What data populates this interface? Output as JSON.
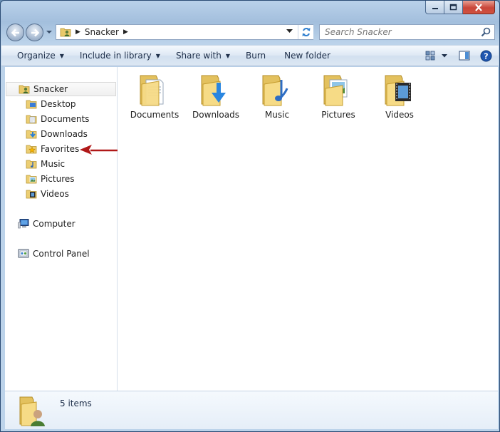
{
  "window": {
    "title": "Snacker",
    "caption": {
      "minimize": "minimize-icon",
      "maximize": "maximize-icon",
      "close": "close-icon"
    }
  },
  "address": {
    "path": [
      "Snacker"
    ],
    "search_placeholder": "Search Snacker"
  },
  "toolbar": {
    "organize": "Organize",
    "include_in_library": "Include in library",
    "share_with": "Share with",
    "burn": "Burn",
    "new_folder": "New folder"
  },
  "navpane": {
    "root": "Snacker",
    "children": [
      "Desktop",
      "Documents",
      "Downloads",
      "Favorites",
      "Music",
      "Pictures",
      "Videos"
    ],
    "computer": "Computer",
    "control_panel": "Control Panel"
  },
  "content": {
    "items": [
      {
        "label": "Documents",
        "icon": "documents-folder-icon"
      },
      {
        "label": "Downloads",
        "icon": "downloads-folder-icon"
      },
      {
        "label": "Music",
        "icon": "music-folder-icon"
      },
      {
        "label": "Pictures",
        "icon": "pictures-folder-icon"
      },
      {
        "label": "Videos",
        "icon": "videos-folder-icon"
      }
    ]
  },
  "details": {
    "count": "5 items"
  },
  "colors": {
    "annotation_arrow": "#b01818",
    "folder": "#f3d27a"
  }
}
